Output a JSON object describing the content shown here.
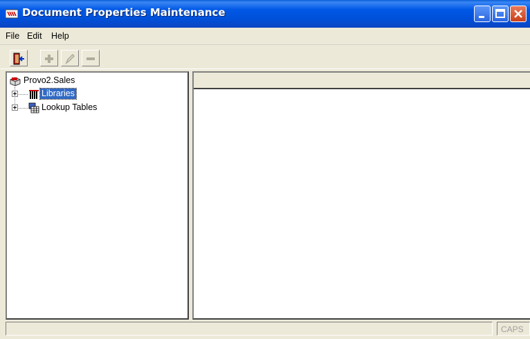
{
  "window": {
    "title": "Document Properties Maintenance",
    "title_bar_color": "#0054e3",
    "controls": [
      "minimize",
      "maximize",
      "close"
    ]
  },
  "menu": {
    "items": [
      {
        "label": "File"
      },
      {
        "label": "Edit"
      },
      {
        "label": "Help"
      }
    ]
  },
  "toolbar": {
    "buttons": [
      {
        "name": "exit",
        "icon": "exit-door-icon",
        "enabled": true
      },
      {
        "name": "add",
        "icon": "plus-icon",
        "enabled": false
      },
      {
        "name": "edit",
        "icon": "pencil-icon",
        "enabled": false
      },
      {
        "name": "delete",
        "icon": "minus-icon",
        "enabled": false
      }
    ]
  },
  "tree": {
    "root": {
      "label": "Provo2.Sales",
      "icon": "database-icon"
    },
    "children": [
      {
        "label": "Libraries",
        "icon": "library-books-icon",
        "selected": true,
        "expandable": true
      },
      {
        "label": "Lookup Tables",
        "icon": "lookup-table-icon",
        "selected": false,
        "expandable": true
      }
    ]
  },
  "list": {
    "columns": []
  },
  "status": {
    "message": "",
    "caps": "CAPS"
  },
  "colors": {
    "selection": "#316ac5",
    "face": "#ece9d8"
  }
}
